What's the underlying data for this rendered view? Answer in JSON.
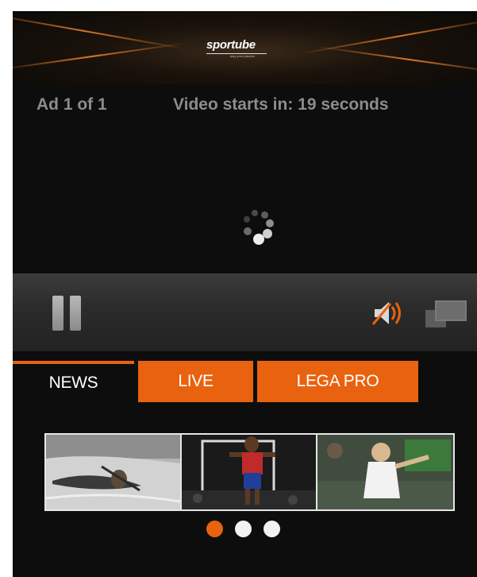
{
  "header": {
    "logo_text": "sportube",
    "logo_tagline": "play your passion",
    "brand_color": "#e8620f"
  },
  "ad": {
    "count_label": "Ad 1 of 1",
    "countdown_label": "Video starts in: 19 seconds"
  },
  "player": {
    "state": "loading",
    "pause_icon": "pause-icon",
    "volume_icon": "volume-icon",
    "fullscreen_icon": "fullscreen-icon"
  },
  "tabs": [
    {
      "label": "NEWS",
      "active": true
    },
    {
      "label": "LIVE",
      "active": false
    },
    {
      "label": "LEGA PRO",
      "active": false
    }
  ],
  "carousel": {
    "thumbnails": [
      {
        "subject": "canoe slalom"
      },
      {
        "subject": "basketball player"
      },
      {
        "subject": "tennis player"
      }
    ],
    "pages": 3,
    "current_page": 1
  }
}
